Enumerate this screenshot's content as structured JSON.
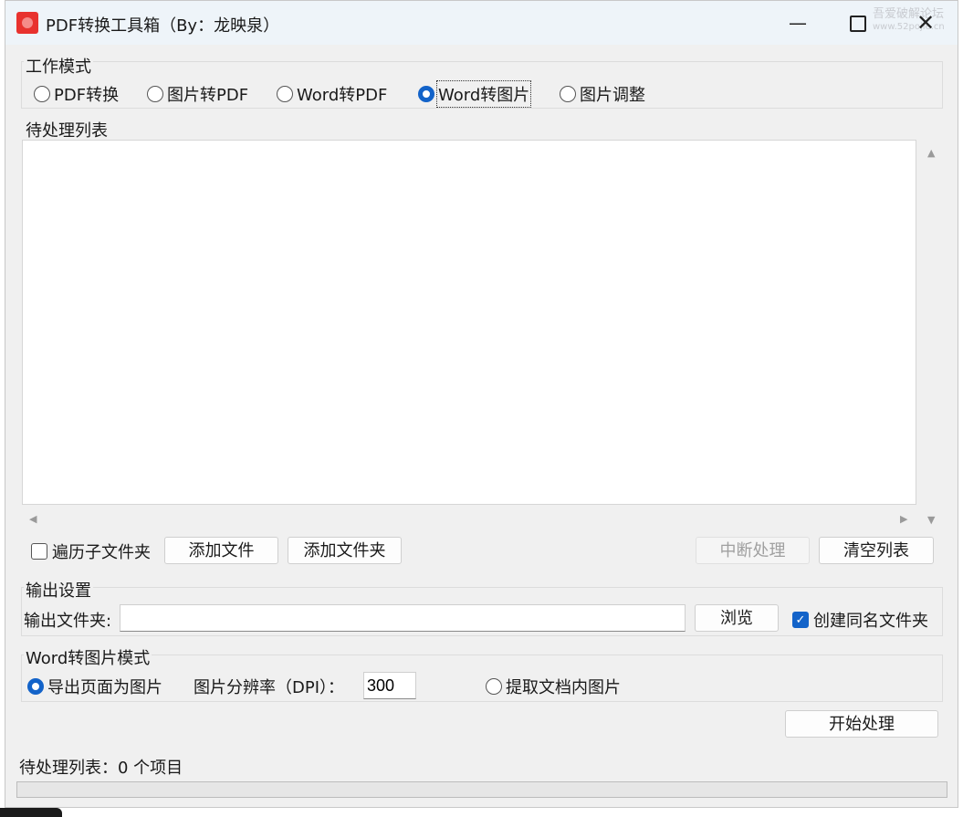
{
  "window": {
    "title": "PDF转换工具箱（By：龙映泉）",
    "minimize": "—",
    "close": "✕",
    "watermark": [
      "吾爱破解论坛",
      "www.52pojie.cn"
    ]
  },
  "work_mode": {
    "legend": "工作模式",
    "options": [
      "PDF转换",
      "图片转PDF",
      "Word转PDF",
      "Word转图片",
      "图片调整"
    ],
    "selected": "Word转图片"
  },
  "pending_list": {
    "legend": "待处理列表",
    "items": []
  },
  "list_actions": {
    "recurse_checkbox": "遍历子文件夹",
    "recurse_checked": false,
    "add_file": "添加文件",
    "add_folder": "添加文件夹",
    "interrupt": "中断处理",
    "clear_list": "清空列表"
  },
  "output": {
    "legend": "输出设置",
    "folder_label": "输出文件夹:",
    "folder_value": "",
    "browse": "浏览",
    "create_same_name": "创建同名文件夹",
    "create_same_name_checked": true
  },
  "word_to_image": {
    "legend": "Word转图片模式",
    "export_pages": "导出页面为图片",
    "export_pages_selected": true,
    "dpi_label": "图片分辨率（DPI）：",
    "dpi_value": "300",
    "extract_images": "提取文档内图片",
    "extract_images_selected": false
  },
  "start_button": "开始处理",
  "status": "待处理列表：0 个项目",
  "progress": 0,
  "colors": {
    "accent": "#1363c9",
    "app_icon": "#e8322e",
    "window_bg": "#f0f0f0"
  }
}
